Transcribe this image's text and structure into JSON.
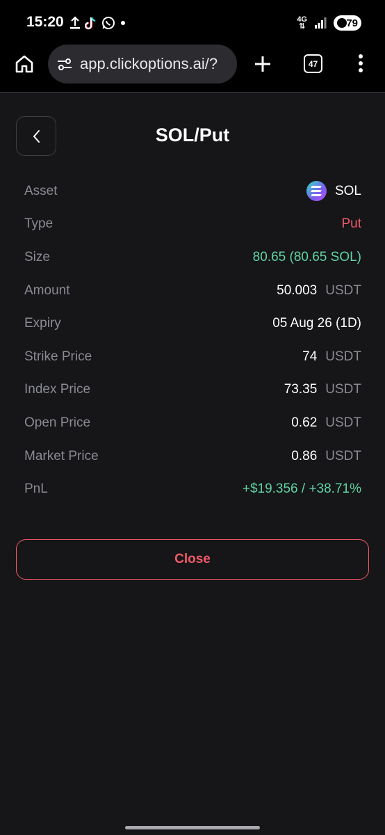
{
  "status_bar": {
    "time": "15:20",
    "left_icons": [
      "upload-icon",
      "tiktok-icon",
      "whatsapp-icon",
      "dot-icon"
    ],
    "network_label": "4G",
    "battery_level": "79"
  },
  "browser": {
    "url": "app.clickoptions.ai/?",
    "tab_count": "47"
  },
  "page": {
    "title": "SOL/Put",
    "close_label": "Close"
  },
  "details": {
    "asset": {
      "label": "Asset",
      "value": "SOL"
    },
    "type": {
      "label": "Type",
      "value": "Put"
    },
    "size": {
      "label": "Size",
      "value": "80.65 (80.65 SOL)"
    },
    "amount": {
      "label": "Amount",
      "value": "50.003",
      "unit": "USDT"
    },
    "expiry": {
      "label": "Expiry",
      "value": "05 Aug 26 (1D)"
    },
    "strike_price": {
      "label": "Strike Price",
      "value": "74",
      "unit": "USDT"
    },
    "index_price": {
      "label": "Index Price",
      "value": "73.35",
      "unit": "USDT"
    },
    "open_price": {
      "label": "Open Price",
      "value": "0.62",
      "unit": "USDT"
    },
    "market_price": {
      "label": "Market Price",
      "value": "0.86",
      "unit": "USDT"
    },
    "pnl": {
      "label": "PnL",
      "value": "+$19.356 / +38.71%"
    }
  },
  "colors": {
    "background": "#161618",
    "positive": "#5fd3a3",
    "negative": "#f25a67",
    "muted": "#8a8a94"
  }
}
